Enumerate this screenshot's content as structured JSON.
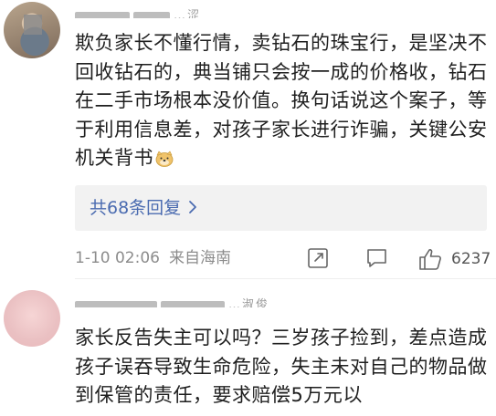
{
  "comments": [
    {
      "username": "…涩",
      "text": "欺负家长不懂行情，卖钻石的珠宝行，是坚决不回收钻石的，典当铺只会按一成的价格收，钻石在二手市场根本没价值。换句话说这个案子，等于利用信息差，对孩子家长进行诈骗，关键公安机关背书",
      "emoji": "doge-emoji",
      "replies_label": "共68条回复",
      "date": "1-10 02:06",
      "location": "来自海南",
      "likes": "6237"
    },
    {
      "username": "…淑俊",
      "text": "家长反告失主可以吗？三岁孩子捡到，差点造成孩子误吞导致生命危险，失主未对自己的物品做到保管的责任，要求赔偿5万元以"
    }
  ],
  "icons": {
    "share": "share-icon",
    "comment": "comment-icon",
    "like": "thumbs-up-icon",
    "chevron": "chevron-right-icon"
  },
  "colors": {
    "link": "#4a6bb0",
    "meta": "#8c8c8c",
    "reply_bg": "#f2f2f2"
  }
}
